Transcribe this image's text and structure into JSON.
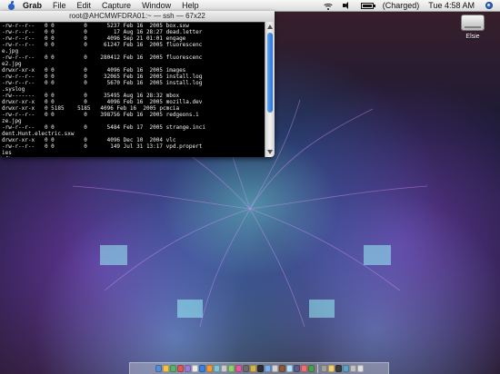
{
  "menubar": {
    "app": "Grab",
    "items": [
      "File",
      "Edit",
      "Capture",
      "Window",
      "Help"
    ],
    "battery_status": "(Charged)",
    "clock": "Tue 4:58 AM"
  },
  "terminal": {
    "title": "root@AHCMWFDRA01:~ — ssh — 67x22",
    "lines": [
      "-rw-r--r--   0 0         0      5237 Feb 16  2005 box.sxw",
      "-rw-r--r--   0 0         0        17 Aug 16 28:27 dead.letter",
      "-rw-r--r--   0 0         0      4096 Sep 21 01:01 engage",
      "-rw-r--r--   0 0         0     61247 Feb 16  2005 fluorescenc",
      "e.jpg",
      "-rw-r--r--   0 0         0    280412 Feb 16  2005 fluorescenc",
      "e2.jpg",
      "drwxr-xr-x   0 0         0      4096 Feb 16  2005 images",
      "-rw-r--r--   0 0         0     32065 Feb 16  2005 install.log",
      "-rw-r--r--   0 0         0      5670 Feb 16  2005 install.log",
      ".syslog",
      "-rw-------   0 0         0     35495 Aug 16 28:32 mbox",
      "drwxr-xr-x   0 0         0      4096 Feb 16  2005 mozilla.dev",
      "drwxr-xr-x   0 5185    5185   4096 Feb 16  2005 pcmcia",
      "-rw-r--r--   0 0         0    398756 Feb 16  2005 redgeons.i",
      "ze.jpg",
      "-rw-r--r--   0 0         0      5484 Feb 17  2005 strange.inci",
      "dent.Hunt.electric.sxw",
      "drwxr-xr-x   0 0         0      4096 Dec 10  2004 vlc",
      "-rw-r--r--   0 0         0       149 Jul 31 13:17 vpd.propert",
      "ies",
      "sftp> "
    ]
  },
  "desktop": {
    "drive_label": "Elsie"
  },
  "dock": {
    "colors": [
      "#5a8bd6",
      "#f3c449",
      "#5bb16a",
      "#d95757",
      "#9b7bd6",
      "#e8e8e8",
      "#3b7fe0",
      "#f39b3a",
      "#7cc6d6",
      "#c9c9c9",
      "#8fd16a",
      "#e65aa0",
      "#6c6c6c",
      "#d6b34a",
      "#2f2f2f",
      "#78b1f0",
      "#d3d3d3",
      "#8b5a3c",
      "#b3e0ff",
      "#5c5c8a",
      "#f07070",
      "#4f9b4f",
      "#a0a0a0",
      "#f2d070",
      "#3c3c3c",
      "#5fa0c8",
      "#c0c0c0",
      "#e0e0e0"
    ]
  }
}
